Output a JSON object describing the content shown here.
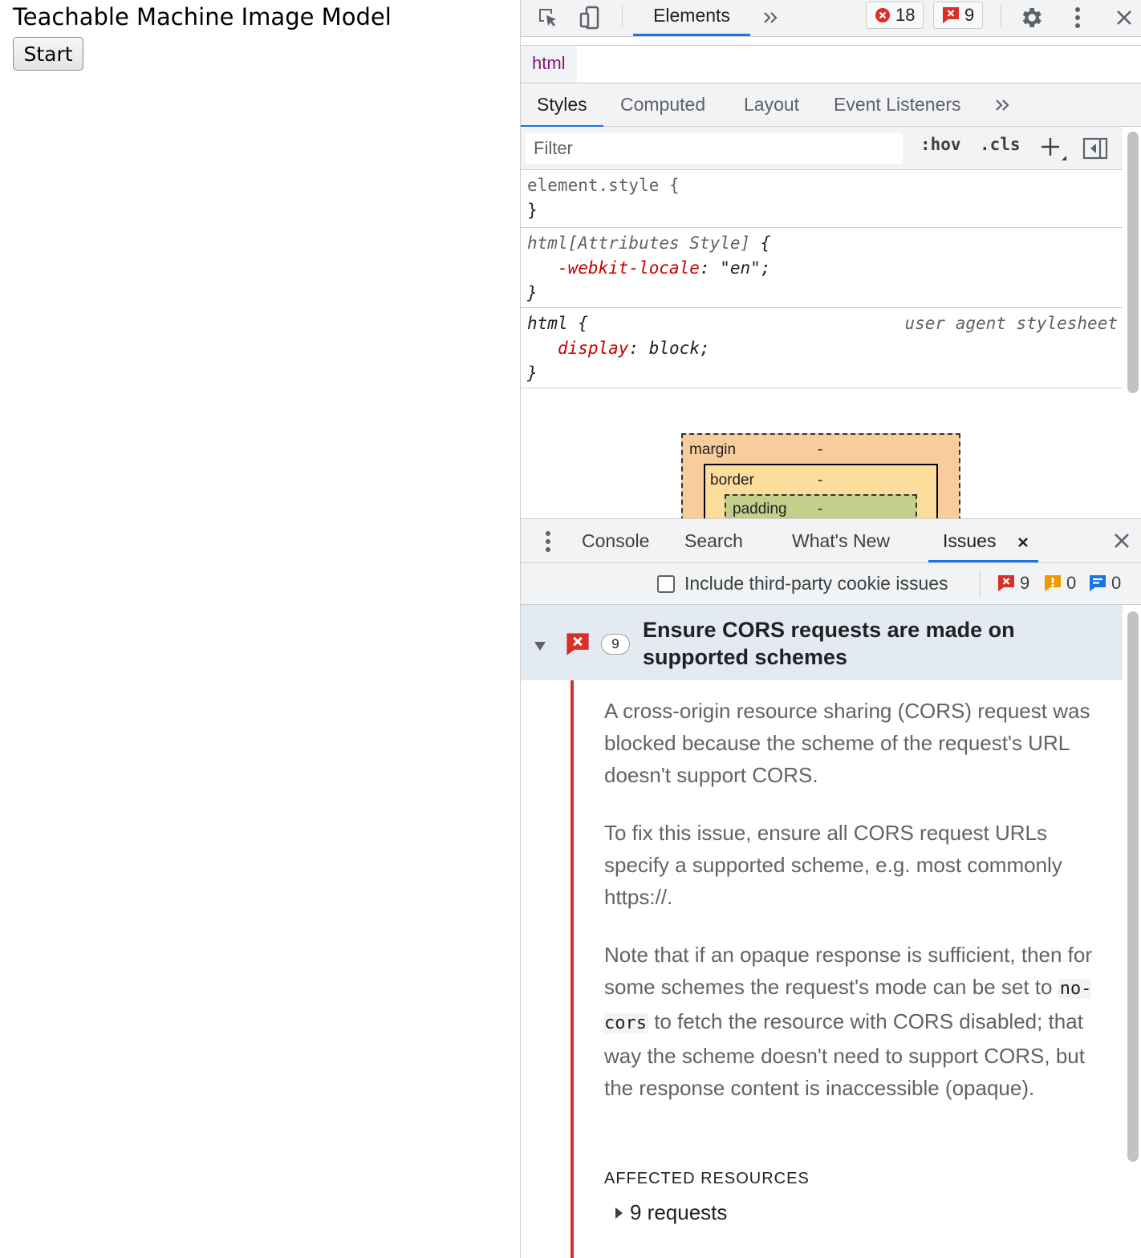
{
  "page": {
    "heading": "Teachable Machine Image Model",
    "start_label": "Start"
  },
  "devtools": {
    "main_tab": "Elements",
    "error_count": "18",
    "issue_count": "9",
    "breadcrumb": "html",
    "style_tabs": [
      "Styles",
      "Computed",
      "Layout",
      "Event Listeners"
    ],
    "filter_placeholder": "Filter",
    "hov_label": ":hov",
    "cls_label": ".cls",
    "rules": {
      "element_style": {
        "selector": "element.style {",
        "close": "}"
      },
      "attr_style": {
        "selector": "html[Attributes Style]",
        "brace": " {",
        "prop": "-webkit-locale",
        "value": "\"en\"",
        "close": "}"
      },
      "ua": {
        "selector": "html {",
        "origin": "user agent stylesheet",
        "prop": "display",
        "value": "block",
        "close": "}"
      }
    },
    "box_model": {
      "margin": "margin",
      "margin_val": "-",
      "border": "border",
      "border_val": "-",
      "padding": "padding",
      "padding_val": "-"
    },
    "drawer_tabs": [
      "Console",
      "Search",
      "What's New",
      "Issues"
    ],
    "issues_toolbar": {
      "checkbox_label": "Include third-party cookie issues",
      "errors": "9",
      "warnings": "0",
      "info": "0"
    },
    "issue": {
      "count": "9",
      "title": "Ensure CORS requests are made on supported schemes",
      "para1": "A cross-origin resource sharing (CORS) request was blocked because the scheme of the request's URL doesn't support CORS.",
      "para2": "To fix this issue, ensure all CORS request URLs specify a supported scheme, e.g. most commonly https://.",
      "para3_before": "Note that if an opaque response is sufficient, then for some schemes the request's mode can be set to ",
      "para3_code": "no-cors",
      "para3_after": " to fetch the resource with CORS disabled; that way the scheme doesn't need to support CORS, but the response content is inaccessible (opaque).",
      "affected_label": "AFFECTED RESOURCES",
      "requests_label": "9 requests"
    },
    "colors": {
      "accent": "#1a73e8",
      "error": "#d93025",
      "warning": "#f29900",
      "info": "#1a73e8"
    }
  }
}
